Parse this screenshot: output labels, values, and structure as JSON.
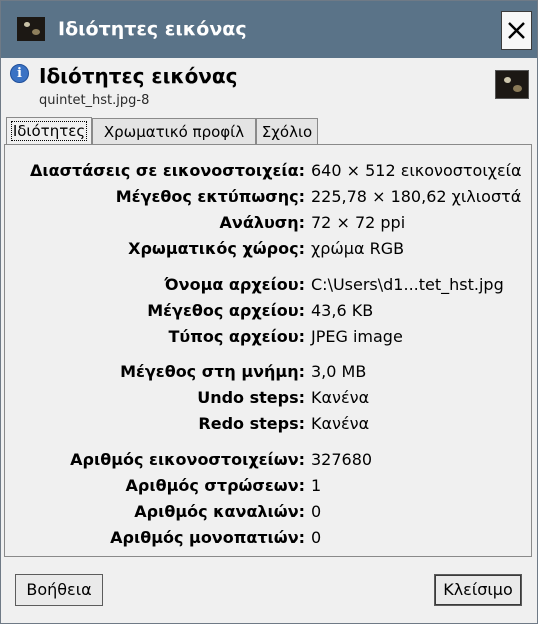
{
  "window": {
    "title": "Ιδιότητες εικόνας"
  },
  "header": {
    "title": "Ιδιότητες εικόνας",
    "subtitle": "quintet_hst.jpg-8"
  },
  "tabs": [
    {
      "label": "Ιδιότητες",
      "active": true
    },
    {
      "label": "Χρωματικό προφίλ",
      "active": false
    },
    {
      "label": "Σχόλιο",
      "active": false
    }
  ],
  "properties": [
    {
      "label": "Διαστάσεις σε εικονοστοιχεία:",
      "value": "640 × 512 εικονοστοιχεία"
    },
    {
      "label": "Μέγεθος εκτύπωσης:",
      "value": "225,78 × 180,62 χιλιοστά"
    },
    {
      "label": "Ανάλυση:",
      "value": "72 × 72 ppi"
    },
    {
      "label": "Χρωματικός χώρος:",
      "value": "χρώμα RGB"
    },
    {
      "label": "Όνομα αρχείου:",
      "value": "C:\\Users\\d1...tet_hst.jpg"
    },
    {
      "label": "Μέγεθος αρχείου:",
      "value": "43,6 KB"
    },
    {
      "label": "Τύπος αρχείου:",
      "value": "JPEG image"
    },
    {
      "label": "Μέγεθος στη μνήμη:",
      "value": "3,0 MB"
    },
    {
      "label": "Undo steps:",
      "value": "Κανένα"
    },
    {
      "label": "Redo steps:",
      "value": "Κανένα"
    },
    {
      "label": "Αριθμός εικονοστοιχείων:",
      "value": "327680"
    },
    {
      "label": "Αριθμός στρώσεων:",
      "value": "1"
    },
    {
      "label": "Αριθμός καναλιών:",
      "value": "0"
    },
    {
      "label": "Αριθμός μονοπατιών:",
      "value": "0"
    }
  ],
  "buttons": {
    "help": "Βοήθεια",
    "close": "Κλείσιμο"
  },
  "icons": {
    "window": "image-thumbnail-icon",
    "close": "close-icon",
    "info": "info-icon",
    "preview": "image-preview-icon"
  },
  "colors": {
    "titlebar": "#5a7388",
    "info": "#3a72c4"
  }
}
